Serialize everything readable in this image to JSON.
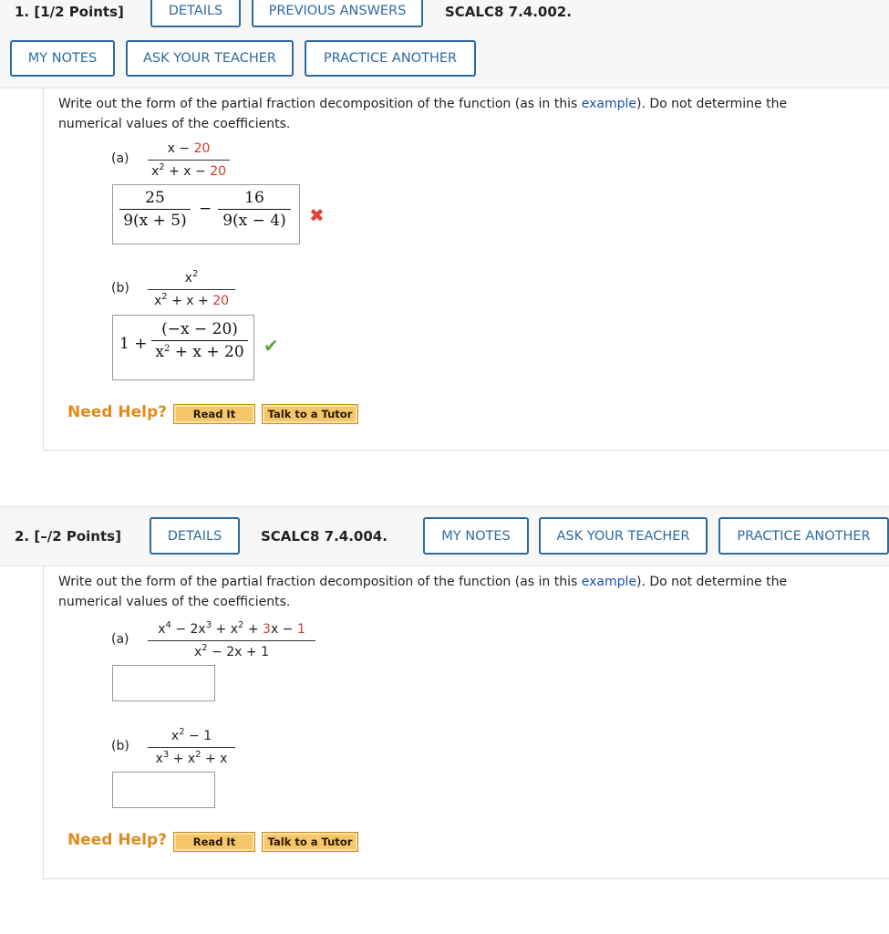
{
  "q1": {
    "number": "1. [1/2 Points]",
    "buttons": {
      "details": "DETAILS",
      "previous": "PREVIOUS ANSWERS",
      "my_notes": "MY NOTES",
      "ask_teacher": "ASK YOUR TEACHER",
      "practice": "PRACTICE ANOTHER"
    },
    "code": "SCALC8 7.4.002.",
    "prompt_before": "Write out the form of the partial fraction decomposition of the function (as in this ",
    "prompt_link": "example",
    "prompt_after": "). Do not determine the numerical values of the coefficients.",
    "part_a": {
      "label": "(a)",
      "num_main": "x − ",
      "num_red": "20",
      "den_base": "x",
      "den_exp": "2",
      "den_mid": " + x − ",
      "den_red": "20",
      "answer": {
        "f1_num": "25",
        "f1_den": "9(x + 5)",
        "op": "−",
        "f2_num": "16",
        "f2_den": "9(x − 4)"
      },
      "status": "incorrect",
      "status_icon": "✖"
    },
    "part_b": {
      "label": "(b)",
      "num_base": "x",
      "num_exp": "2",
      "den_base": "x",
      "den_exp": "2",
      "den_mid": " + x + ",
      "den_red": "20",
      "answer": {
        "prefix": "1 +",
        "num": "(−x − 20)",
        "den_base": "x",
        "den_exp": "2",
        "den_rest": " + x + 20"
      },
      "status": "correct",
      "status_icon": "✔"
    },
    "help": {
      "label": "Need Help?",
      "read": "Read It",
      "tutor": "Talk to a Tutor"
    }
  },
  "q2": {
    "number": "2. [–/2 Points]",
    "buttons": {
      "details": "DETAILS",
      "my_notes": "MY NOTES",
      "ask_teacher": "ASK YOUR TEACHER",
      "practice": "PRACTICE ANOTHER"
    },
    "code": "SCALC8 7.4.004.",
    "prompt_before": "Write out the form of the partial fraction decomposition of the function (as in this ",
    "prompt_link": "example",
    "prompt_after": "). Do not determine the numerical values of the coefficients.",
    "part_a": {
      "label": "(a)",
      "num_p1": "x",
      "num_e1": "4",
      "num_p2": " − 2x",
      "num_e2": "3",
      "num_p3": " + x",
      "num_e3": "2",
      "num_p4": " + ",
      "num_red1": "3",
      "num_p5": "x − ",
      "num_red2": "1",
      "den_base": "x",
      "den_exp": "2",
      "den_rest": " − 2x + 1",
      "answer": ""
    },
    "part_b": {
      "label": "(b)",
      "num_base": "x",
      "num_exp": "2",
      "num_rest": " − 1",
      "den_p1": "x",
      "den_e1": "3",
      "den_p2": " + x",
      "den_e2": "2",
      "den_p3": " + x",
      "answer": ""
    },
    "help": {
      "label": "Need Help?",
      "read": "Read It",
      "tutor": "Talk to a Tutor"
    }
  },
  "colors": {
    "accent": "#2d6aa0",
    "link": "#1c4fb0",
    "coefficient_red": "#d23a2a",
    "help_orange": "#e08c1c",
    "help_button": "#f5c76a",
    "correct": "#5aa53e",
    "incorrect": "#e0413a"
  }
}
